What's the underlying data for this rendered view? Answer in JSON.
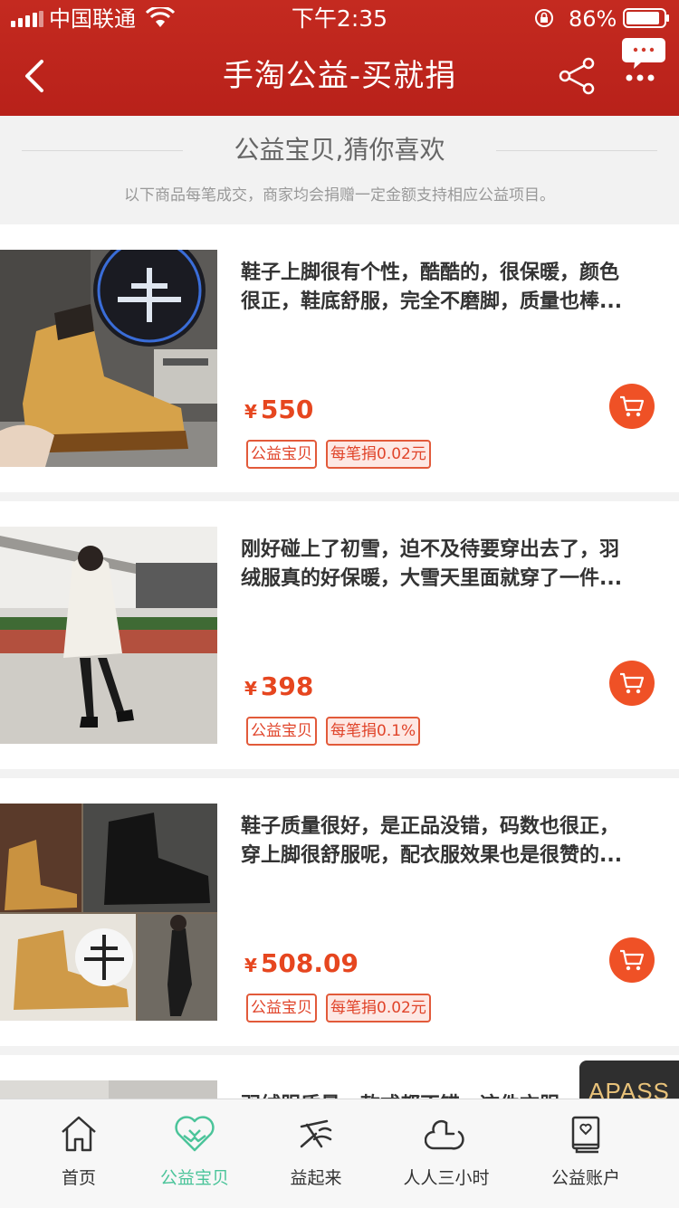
{
  "status_bar": {
    "carrier": "中国联通",
    "time": "下午2:35",
    "battery": "86%"
  },
  "nav": {
    "title": "手淘公益-买就捐",
    "back_icon": "chevron-left-icon",
    "share_icon": "share-icon",
    "more_icon": "more-dots-icon"
  },
  "section": {
    "title": "公益宝贝,猜你喜欢",
    "subtitle": "以下商品每笔成交，商家均会捐赠一定金额支持相应公益项目。"
  },
  "products": [
    {
      "desc_line1": "鞋子上脚很有个性，酷酷的，很保暖，颜色",
      "desc_line2": "很正，鞋底舒服，完全不磨脚，质量也棒...",
      "currency": "¥",
      "price": "550",
      "tag_charity": "公益宝贝",
      "tag_donate": "每笔捐0.02元"
    },
    {
      "desc_line1": "刚好碰上了初雪，迫不及待要穿出去了，羽",
      "desc_line2": "绒服真的好保暖，大雪天里面就穿了一件...",
      "currency": "¥",
      "price": "398",
      "tag_charity": "公益宝贝",
      "tag_donate": "每笔捐0.1%"
    },
    {
      "desc_line1": "鞋子质量很好，是正品没错，码数也很正，",
      "desc_line2": "穿上脚很舒服呢，配衣服效果也是很赞的...",
      "currency": "¥",
      "price": "508.09",
      "tag_charity": "公益宝贝",
      "tag_donate": "每笔捐0.02元"
    }
  ],
  "partial_product": {
    "desc_line1": "羽绒服质量，款式都不错，这件衣服"
  },
  "watermark": "APASS",
  "tabs": [
    {
      "label": "首页",
      "icon": "home-icon"
    },
    {
      "label": "公益宝贝",
      "icon": "heart-hands-icon"
    },
    {
      "label": "益起来",
      "icon": "signature-icon"
    },
    {
      "label": "人人三小时",
      "icon": "clock-heart-icon"
    },
    {
      "label": "公益账户",
      "icon": "account-book-icon"
    }
  ],
  "colors": {
    "header_red": "#c0241c",
    "price_orange": "#e6461f",
    "active_tab_green": "#4bc49a",
    "cart_orange": "#ef5126"
  }
}
